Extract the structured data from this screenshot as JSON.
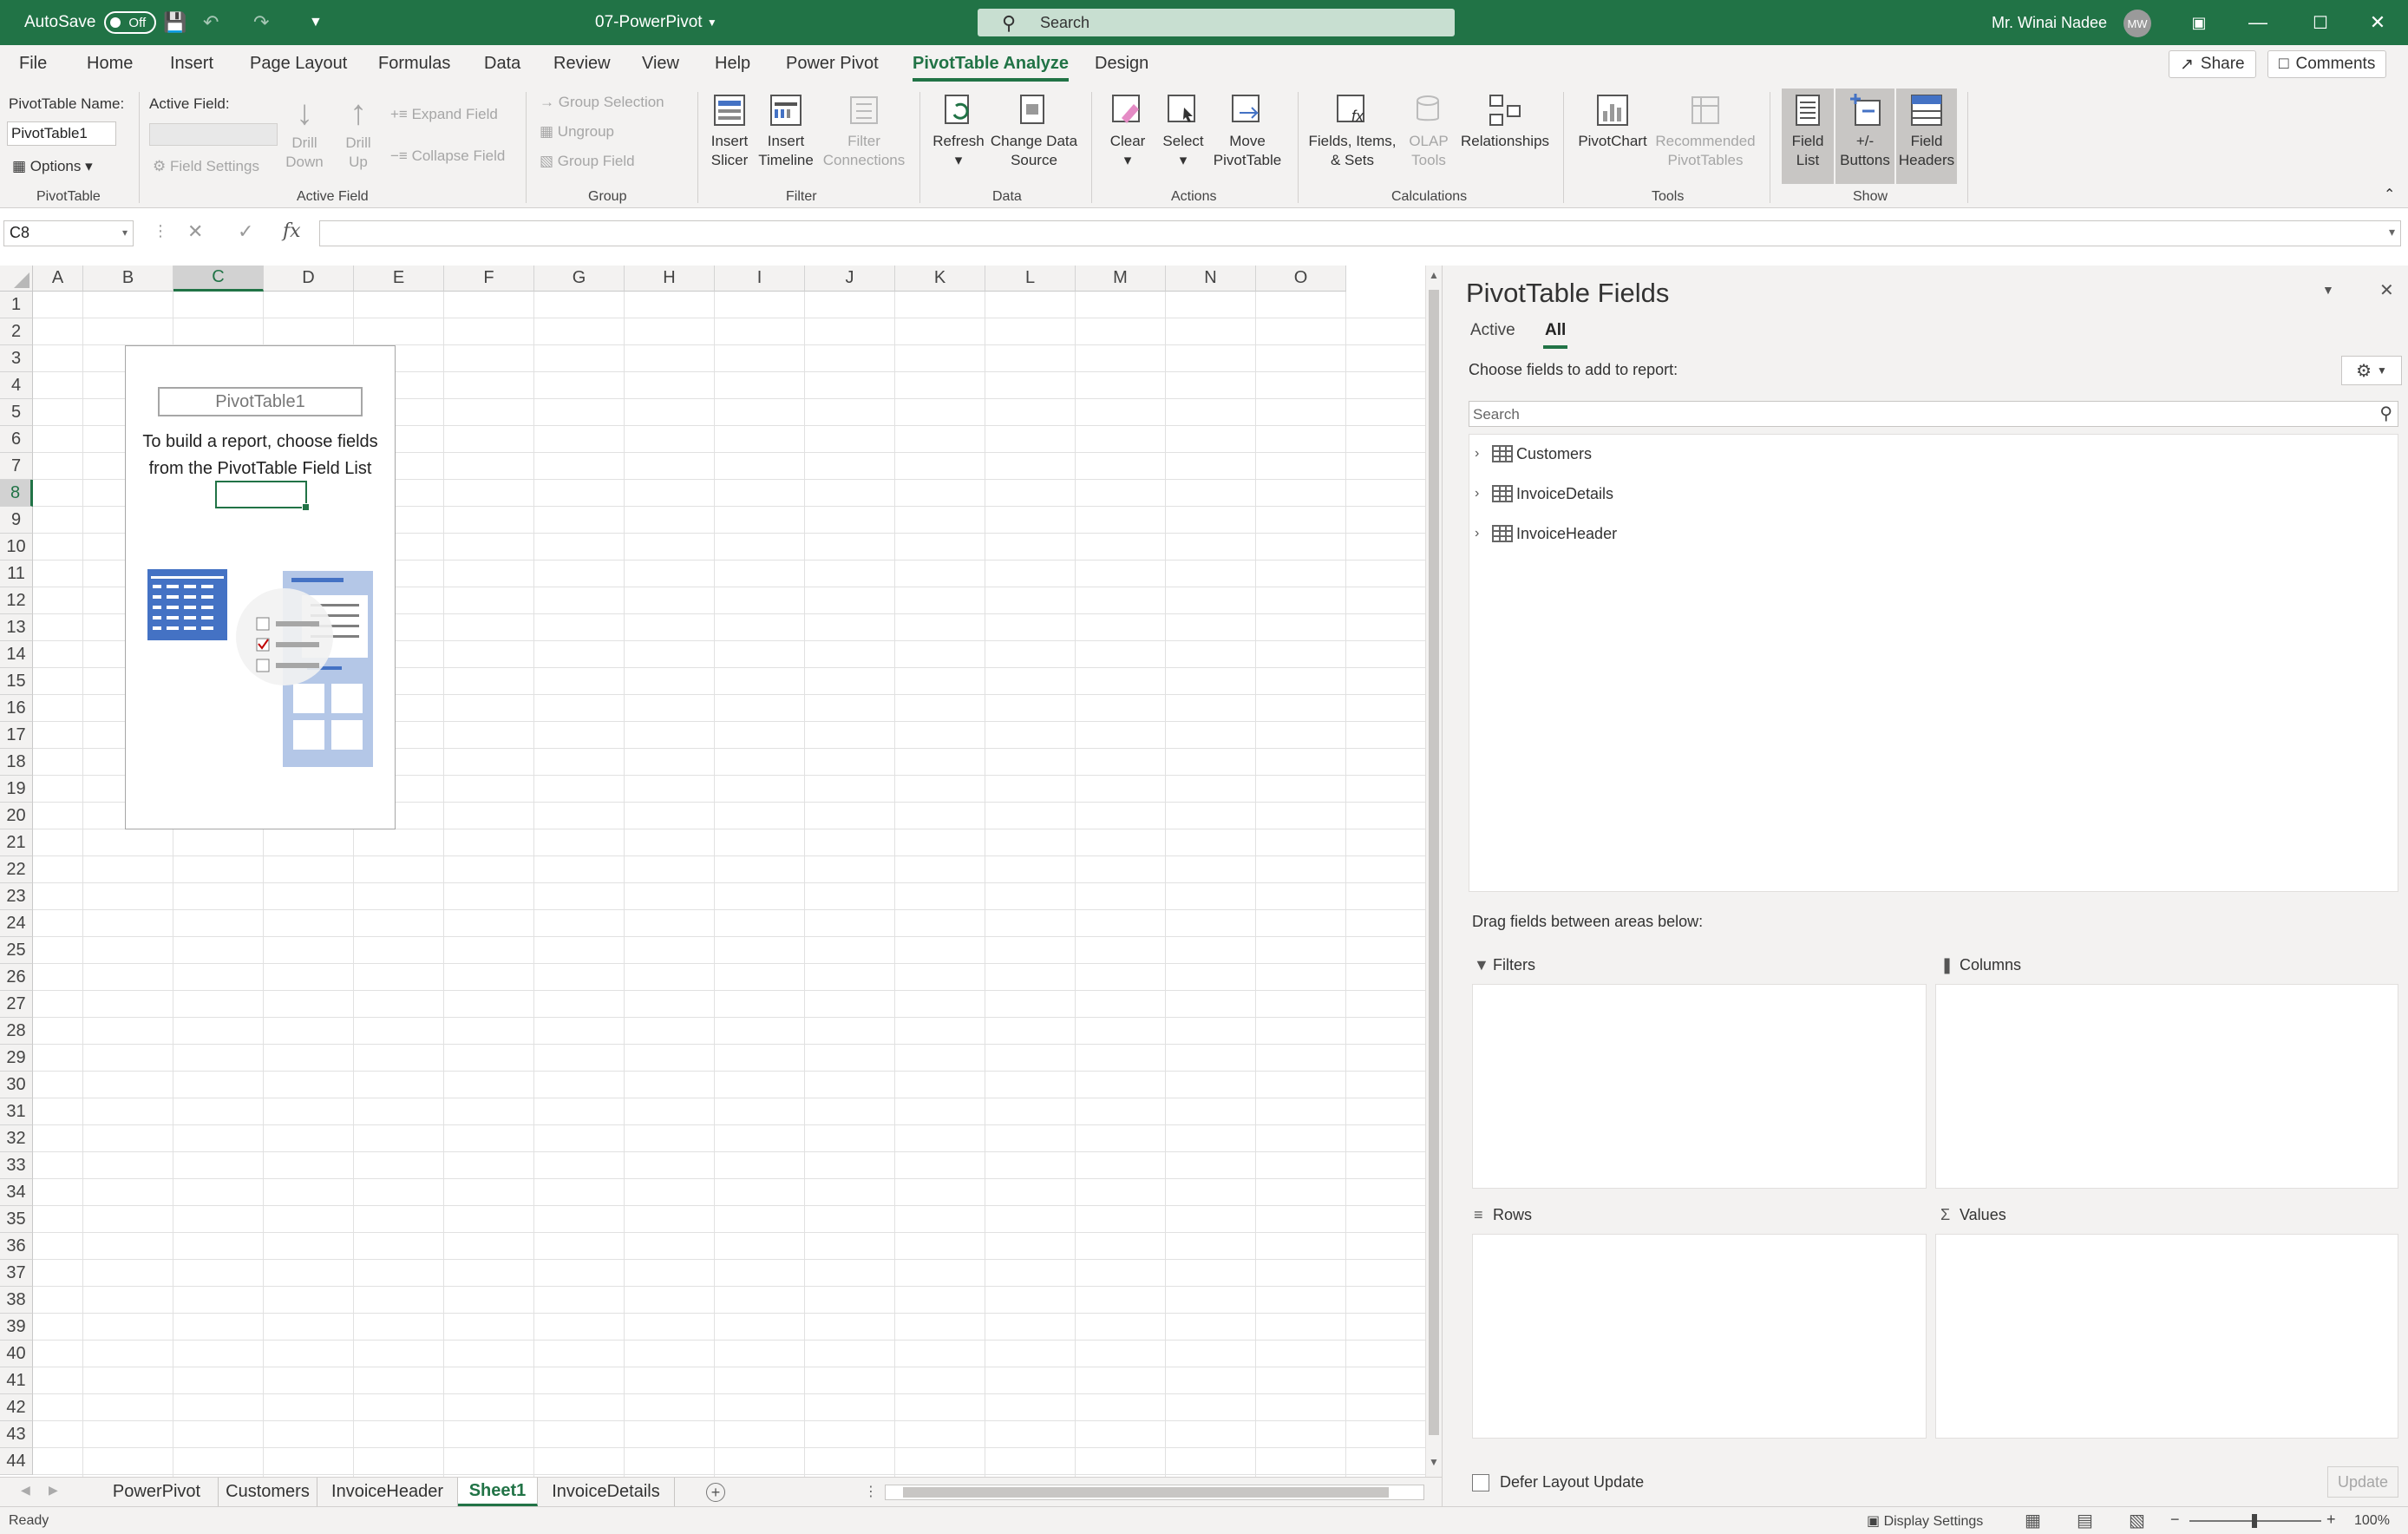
{
  "titlebar": {
    "autosave_label": "AutoSave",
    "autosave_state": "Off",
    "filename": "07-PowerPivot",
    "search_placeholder": "Search",
    "user_name": "Mr. Winai Nadee",
    "user_initials": "MW"
  },
  "ribbon_tabs": [
    "File",
    "Home",
    "Insert",
    "Page Layout",
    "Formulas",
    "Data",
    "Review",
    "View",
    "Help",
    "Power Pivot",
    "PivotTable Analyze",
    "Design"
  ],
  "ribbon_actions": {
    "share": "Share",
    "comments": "Comments"
  },
  "ribbon": {
    "pivottable": {
      "name_label": "PivotTable Name:",
      "name_value": "PivotTable1",
      "options": "Options",
      "group": "PivotTable"
    },
    "active_field": {
      "label": "Active Field:",
      "field_settings": "Field Settings",
      "drill_down": "Drill Down",
      "drill_up": "Drill Up",
      "expand": "Expand Field",
      "collapse": "Collapse Field",
      "group": "Active Field"
    },
    "group": {
      "group_selection": "Group Selection",
      "ungroup": "Ungroup",
      "group_field": "Group Field",
      "group": "Group"
    },
    "filter": {
      "insert_slicer": "Insert Slicer",
      "insert_timeline": "Insert Timeline",
      "filter_connections": "Filter Connections",
      "group": "Filter"
    },
    "data": {
      "refresh": "Refresh",
      "change_source": "Change Data Source",
      "group": "Data"
    },
    "actions": {
      "clear": "Clear",
      "select": "Select",
      "move": "Move PivotTable",
      "group": "Actions"
    },
    "calculations": {
      "fields_items": "Fields, Items, & Sets",
      "olap": "OLAP Tools",
      "relationships": "Relationships",
      "group": "Calculations"
    },
    "tools": {
      "pivotchart": "PivotChart",
      "recommended": "Recommended PivotTables",
      "group": "Tools"
    },
    "show": {
      "field_list": "Field List",
      "buttons": "+/- Buttons",
      "headers": "Field Headers",
      "group": "Show"
    }
  },
  "formula_bar": {
    "name_box": "C8",
    "fx": "fx"
  },
  "grid": {
    "columns": [
      "A",
      "B",
      "C",
      "D",
      "E",
      "F",
      "G",
      "H",
      "I",
      "J",
      "K",
      "L",
      "M",
      "N",
      "O"
    ],
    "selected_column": "C",
    "rows": [
      "1",
      "2",
      "3",
      "4",
      "5",
      "6",
      "7",
      "8",
      "9",
      "10",
      "11",
      "12",
      "13",
      "14",
      "15",
      "16",
      "17",
      "18",
      "19",
      "20",
      "21",
      "22",
      "23",
      "24",
      "25",
      "26",
      "27",
      "28",
      "29",
      "30",
      "31",
      "32",
      "33",
      "34",
      "35",
      "36",
      "37",
      "38",
      "39",
      "40",
      "41",
      "42",
      "43",
      "44"
    ],
    "selected_row": "8"
  },
  "pivot_placeholder": {
    "name": "PivotTable1",
    "instruction_line1": "To build a report, choose fields",
    "instruction_line2": "from the PivotTable Field List"
  },
  "sheet_tabs": [
    "PowerPivot",
    "Customers",
    "InvoiceHeader",
    "Sheet1",
    "InvoiceDetails"
  ],
  "active_sheet": "Sheet1",
  "status": {
    "ready": "Ready",
    "display_settings": "Display Settings",
    "zoom": "100%"
  },
  "field_pane": {
    "title": "PivotTable Fields",
    "tabs": [
      "Active",
      "All"
    ],
    "active_tab": "All",
    "choose_label": "Choose fields to add to report:",
    "search_placeholder": "Search",
    "tables": [
      "Customers",
      "InvoiceDetails",
      "InvoiceHeader"
    ],
    "drag_label": "Drag fields between areas below:",
    "areas": {
      "filters": "Filters",
      "columns": "Columns",
      "rows": "Rows",
      "values": "Values"
    },
    "defer_label": "Defer Layout Update",
    "update_label": "Update"
  },
  "colors": {
    "accent": "#217346",
    "ribbon_bg": "#f3f2f1"
  }
}
